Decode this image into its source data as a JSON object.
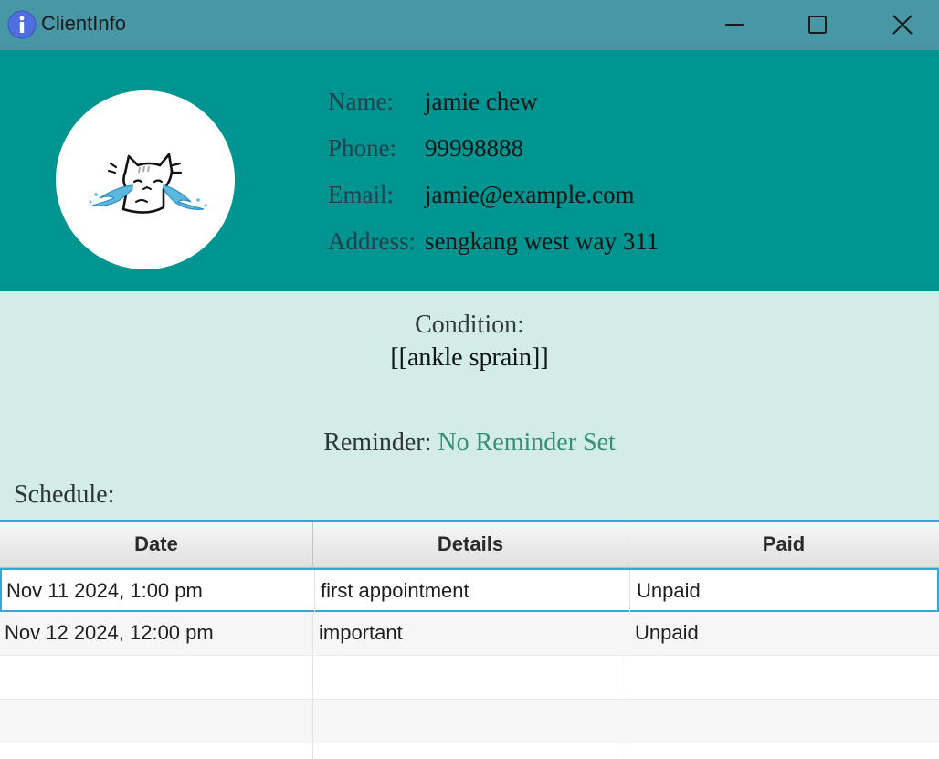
{
  "window": {
    "title": "ClientInfo",
    "icon": "info-icon",
    "controls": [
      "minimize-icon",
      "maximize-icon",
      "close-icon"
    ]
  },
  "client": {
    "labels": {
      "name": "Name:",
      "phone": "Phone:",
      "email": "Email:",
      "address": "Address:"
    },
    "name": "jamie chew",
    "phone": "99998888",
    "email": "jamie@example.com",
    "address": "sengkang west way 311"
  },
  "condition": {
    "label": "Condition:",
    "value": "[[ankle sprain]]"
  },
  "reminder": {
    "label": "Reminder:",
    "value": "No Reminder Set"
  },
  "schedule": {
    "label": "Schedule:",
    "columns": [
      "Date",
      "Details",
      "Paid"
    ],
    "rows": [
      {
        "date": "Nov 11 2024, 1:00 pm",
        "details": "first appointment",
        "paid": "Unpaid"
      },
      {
        "date": "Nov 12 2024, 12:00 pm",
        "details": "important",
        "paid": "Unpaid"
      }
    ]
  },
  "colors": {
    "titlebar": "#4897a6",
    "header": "#009590",
    "body": "#d3ece8",
    "reminder_value": "#369075",
    "selection": "#3aa6d0"
  }
}
